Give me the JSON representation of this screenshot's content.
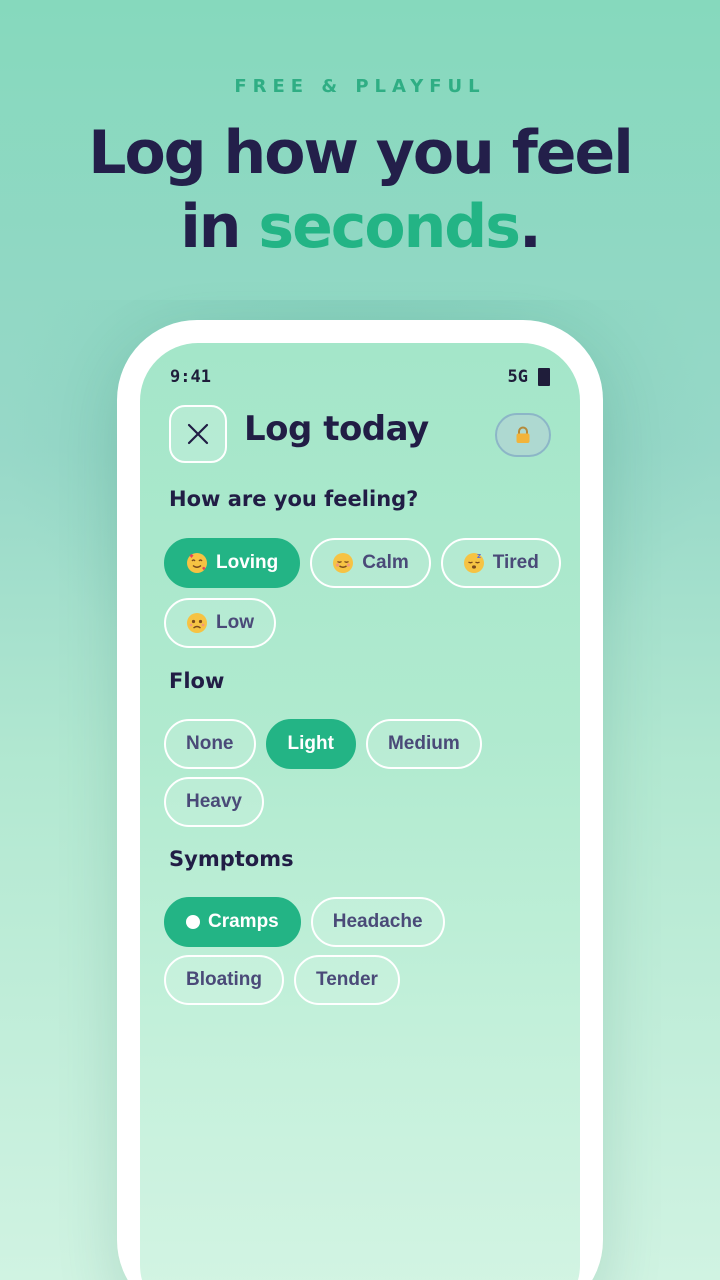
{
  "marketing": {
    "tagline": "FREE & PLAYFUL",
    "headline_line1": "Log how you feel",
    "headline_in": "in ",
    "headline_accent": "seconds",
    "headline_period": "."
  },
  "status_bar": {
    "time": "9:41",
    "network": "5G"
  },
  "header": {
    "title": "Log today",
    "close_icon": "close-icon",
    "lock_icon": "lock-icon"
  },
  "mood": {
    "label": "How are you feeling?",
    "options": [
      {
        "label": "Loving",
        "icon": "loving-face-emoji",
        "selected": true
      },
      {
        "label": "Calm",
        "icon": "calm-face-emoji",
        "selected": false
      },
      {
        "label": "Tired",
        "icon": "sleepy-face-emoji",
        "selected": false
      },
      {
        "label": "Low",
        "icon": "sad-face-emoji",
        "selected": false
      }
    ]
  },
  "flow": {
    "label": "Flow",
    "options": [
      {
        "label": "None",
        "selected": false
      },
      {
        "label": "Light",
        "selected": true
      },
      {
        "label": "Medium",
        "selected": false
      },
      {
        "label": "Heavy",
        "selected": false
      }
    ]
  },
  "symptoms": {
    "label": "Symptoms",
    "options": [
      {
        "label": "Cramps",
        "selected": true
      },
      {
        "label": "Headache",
        "selected": false
      },
      {
        "label": "Bloating",
        "selected": false
      },
      {
        "label": "Tender",
        "selected": false
      }
    ]
  },
  "colors": {
    "accent": "#23b485",
    "heading": "#211d45",
    "chip_text": "#4a4a78"
  }
}
